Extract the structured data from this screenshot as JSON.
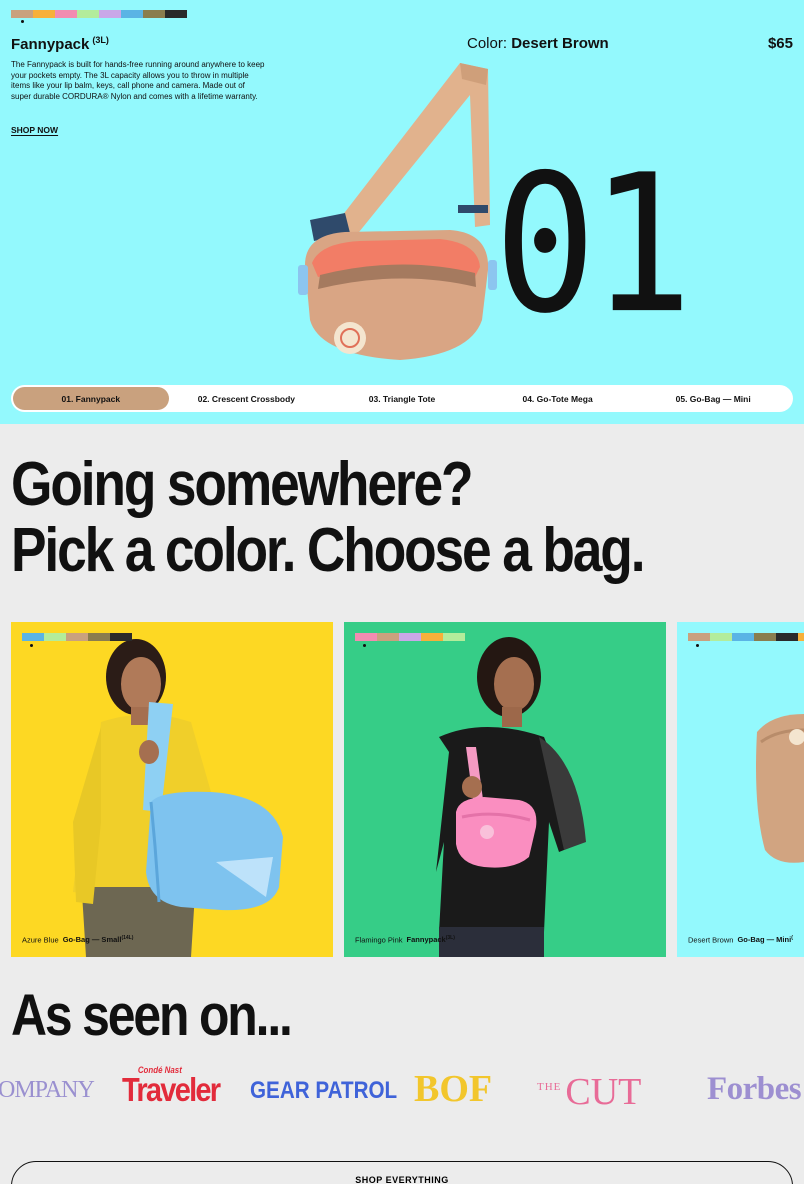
{
  "hero": {
    "swatches": [
      "#c9a17e",
      "#f7b03a",
      "#f28cb1",
      "#b3ec9b",
      "#c9a7e8",
      "#5ab4e5",
      "#8a7d4e",
      "#2a2a2a"
    ],
    "title": "Fannypack",
    "capacity": "(3L)",
    "description": "The Fannypack is built for hands-free running around anywhere to keep your pockets empty. The 3L capacity allows you to throw in multiple items like your lip balm, keys, call phone and camera. Made out of super durable CORDURA® Nylon and comes with a lifetime warranty.",
    "shop_now": "SHOP NOW",
    "color_label": "Color:",
    "color_value": "Desert Brown",
    "price": "$65",
    "big_number": "01",
    "background": "#93f9fd",
    "bag_image": "fannypack-desert-brown"
  },
  "tabs": [
    {
      "label": "01. Fannypack",
      "active": true
    },
    {
      "label": "02. Crescent Crossbody",
      "active": false
    },
    {
      "label": "03. Triangle Tote",
      "active": false
    },
    {
      "label": "04. Go-Tote Mega",
      "active": false
    },
    {
      "label": "05. Go-Bag — Mini",
      "active": false
    }
  ],
  "headline": {
    "line1": "Going somewhere?",
    "line2": "Pick a color. Choose a bag."
  },
  "cards": [
    {
      "background": "#fdd823",
      "swatches": [
        "#5ab4e5",
        "#b3ec9b",
        "#c9a17e",
        "#8a7d4e",
        "#2a2a2a"
      ],
      "color_name": "Azure Blue",
      "product": "Go-Bag — Small",
      "capacity": "(14L)",
      "image": "model-yellow-sweater-blue-bag"
    },
    {
      "background": "#36cd87",
      "swatches": [
        "#f28cb1",
        "#c9a17e",
        "#c9a7e8",
        "#f7b03a",
        "#b3ec9b"
      ],
      "color_name": "Flamingo Pink",
      "product": "Fannypack",
      "capacity": "(3L)",
      "image": "model-black-sweater-pink-fannypack"
    },
    {
      "background": "#93f9fd",
      "swatches": [
        "#c9a17e",
        "#b3ec9b",
        "#5ab4e5",
        "#8a7d4e",
        "#2a2a2a",
        "#f7b03a"
      ],
      "color_name": "Desert Brown",
      "product": "Go-Bag — Mini",
      "capacity": "(",
      "image": "desert-brown-bag"
    }
  ],
  "seen_on": {
    "title": "As seen on...",
    "logos": {
      "company": "OMPANY",
      "traveler_small": "Condé Nast",
      "traveler": "Traveler",
      "gear_patrol": "GEAR PATROL",
      "bof": "BOF",
      "cut_the": "THE",
      "cut": "CUT",
      "forbes": "Forbes"
    }
  },
  "shop_everything": "SHOP EVERYTHING"
}
